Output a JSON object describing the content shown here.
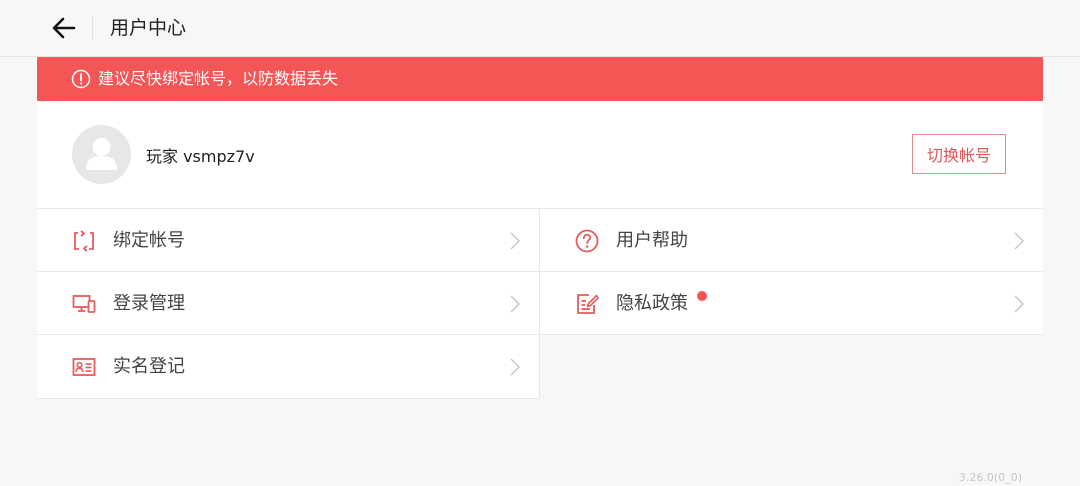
{
  "header": {
    "title": "用户中心"
  },
  "banner": {
    "text": "建议尽快绑定帐号，以防数据丢失"
  },
  "account": {
    "username": "玩家 vsmpz7v",
    "switch_label": "切换帐号"
  },
  "menu": {
    "bind_account": "绑定帐号",
    "user_help": "用户帮助",
    "login_manage": "登录管理",
    "privacy_policy": "隐私政策",
    "real_name": "实名登记"
  },
  "footer": {
    "version": "3.26.0(0_0)"
  },
  "colors": {
    "accent": "#f45656",
    "background": "#f7f7f7"
  }
}
